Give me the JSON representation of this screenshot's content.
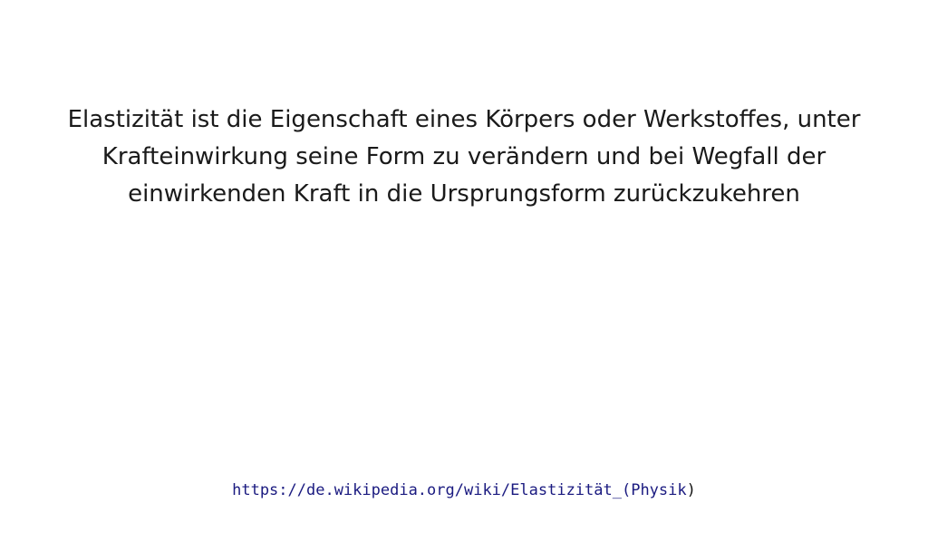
{
  "quote": {
    "lines": [
      "Elastizität ist die Eigenschaft eines Körpers oder Werkstoffes, unter",
      "Krafteinwirkung seine Form zu verändern und bei Wegfall der",
      "einwirkenden Kraft in die Ursprungsform zurückzukehren"
    ]
  },
  "source": {
    "link_text": "https://de.wikipedia.org/wiki/Elastizität_(Physik",
    "trailing_text": ")",
    "link_color": "#1a1a80"
  }
}
